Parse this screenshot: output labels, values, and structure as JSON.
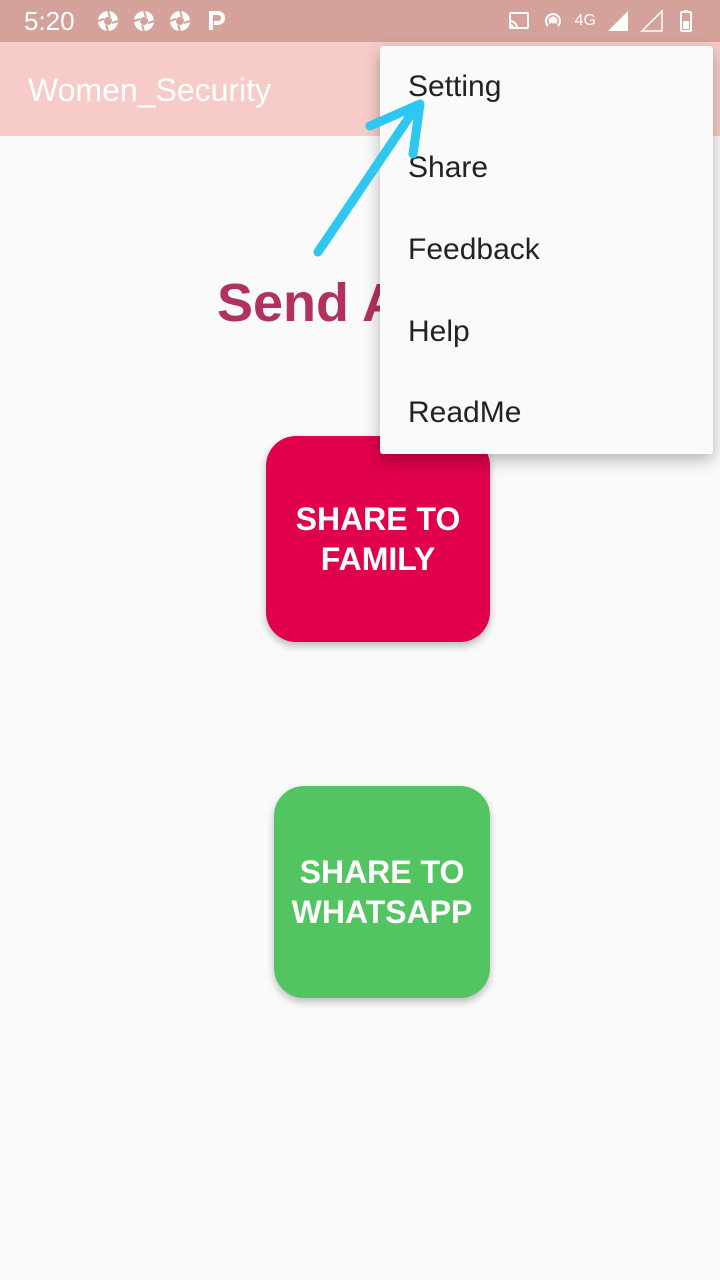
{
  "status_bar": {
    "time": "5:20",
    "network": "4G",
    "left_icons": [
      "shutter-icon",
      "shutter-icon",
      "shutter-icon",
      "p-icon"
    ],
    "right_icons": [
      "cast-icon",
      "hotspot-icon",
      "signal-icon",
      "signal-empty-icon",
      "battery-icon"
    ]
  },
  "app_bar": {
    "title": "Women_Security",
    "color": "#f7ccc8"
  },
  "main": {
    "headline": "Send A",
    "headline_color": "#b2325f",
    "buttons": {
      "family": {
        "label": "SHARE TO\nFAMILY",
        "color": "#e0004b"
      },
      "whatsapp": {
        "label": "SHARE TO\nWHATSAPP",
        "color": "#52c562"
      }
    }
  },
  "overflow_menu": {
    "items": [
      "Setting",
      "Share",
      "Feedback",
      "Help",
      "ReadMe"
    ]
  },
  "annotation": {
    "arrow_color": "#2ec7f2",
    "icon": "arrow-icon"
  }
}
